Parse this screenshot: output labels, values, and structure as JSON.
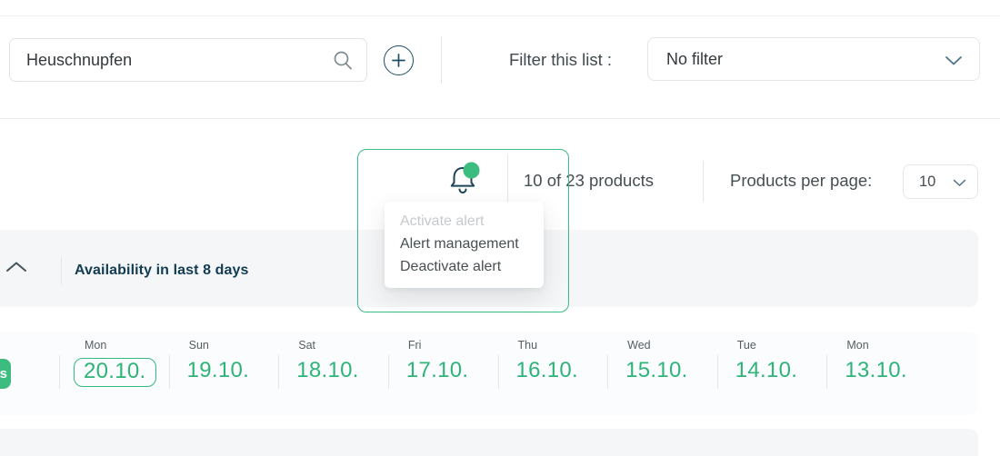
{
  "colors": {
    "accent_green": "#2eb378",
    "accent_green_border": "#35b97e",
    "navy": "#1d4c66",
    "title_navy": "#123c53",
    "text_dark": "#454e52",
    "text_disabled": "#c6cacc",
    "band_gray": "#f5f6f7",
    "border_gray": "#e3e6e7"
  },
  "icons": {
    "search": "magnifier",
    "add": "plus-in-circle",
    "dropdown": "chevron-down",
    "collapse": "chevron-up",
    "alert": "bell-with-green-dot"
  },
  "topbar": {
    "search": {
      "value": "Heuschnupfen"
    },
    "filter_label": "Filter this list :",
    "filter_value": "No filter"
  },
  "toolbar": {
    "counter": "10 of 23 products",
    "per_page_label": "Products per page:",
    "per_page_value": "10",
    "menu": {
      "items": [
        {
          "label": "Activate alert",
          "disabled": true
        },
        {
          "label": "Alert management",
          "disabled": false
        },
        {
          "label": "Deactivate alert",
          "disabled": false
        }
      ]
    }
  },
  "section": {
    "title": "Availability in last 8 days"
  },
  "days": {
    "edge_badge": "s",
    "cells": [
      {
        "day": "Mon",
        "date": "20.10.",
        "selected": true
      },
      {
        "day": "Sun",
        "date": "19.10.",
        "selected": false
      },
      {
        "day": "Sat",
        "date": "18.10.",
        "selected": false
      },
      {
        "day": "Fri",
        "date": "17.10.",
        "selected": false
      },
      {
        "day": "Thu",
        "date": "16.10.",
        "selected": false
      },
      {
        "day": "Wed",
        "date": "15.10.",
        "selected": false
      },
      {
        "day": "Tue",
        "date": "14.10.",
        "selected": false
      },
      {
        "day": "Mon",
        "date": "13.10.",
        "selected": false
      }
    ]
  }
}
